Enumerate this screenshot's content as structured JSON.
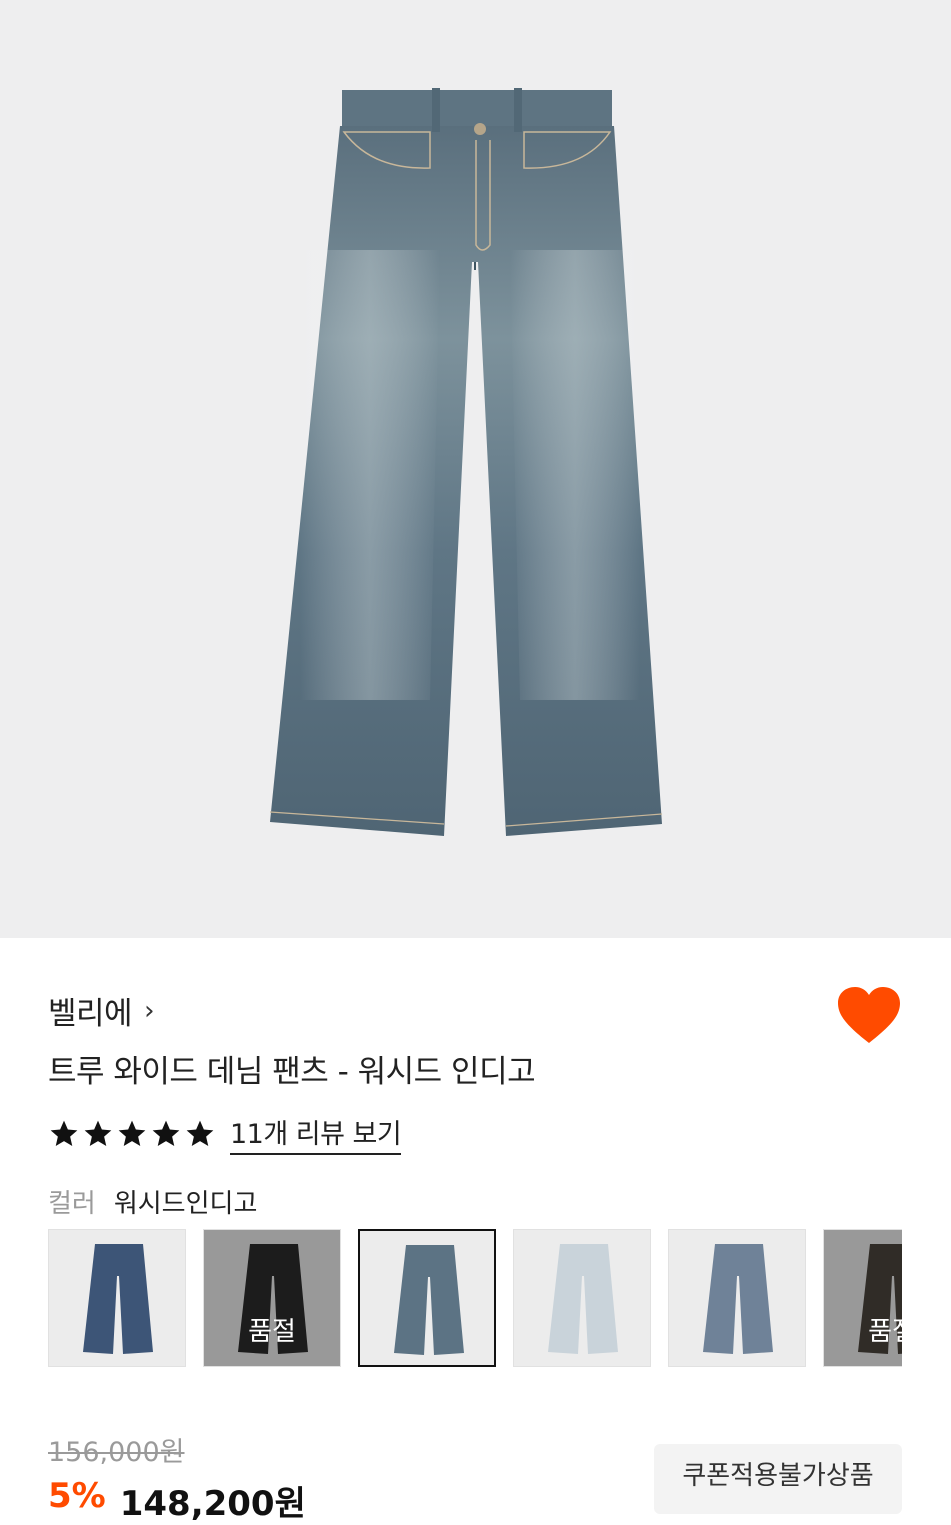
{
  "product": {
    "brand": "벨리에",
    "brand_chevron": "›",
    "title": "트루 와이드 데님 팬츠 - 워시드 인디고",
    "rating_stars": 5,
    "review_link": "11개 리뷰 보기",
    "wishlisted": true
  },
  "color": {
    "label": "컬러",
    "selected": "워시드인디고"
  },
  "swatches": [
    {
      "tone": "#3d5577",
      "soldout": false,
      "selected": false
    },
    {
      "tone": "#2b2b2b",
      "soldout": true,
      "selected": false,
      "soldout_label": "품절"
    },
    {
      "tone": "#5c7384",
      "soldout": false,
      "selected": true
    },
    {
      "tone": "#c9d3da",
      "soldout": false,
      "selected": false
    },
    {
      "tone": "#6f8298",
      "soldout": false,
      "selected": false
    },
    {
      "tone": "#4a443c",
      "soldout": true,
      "selected": false,
      "soldout_label": "품절"
    }
  ],
  "price": {
    "original": "156,000원",
    "discount": "5%",
    "final": "148,200원",
    "coupon_badge": "쿠폰적용불가상품"
  },
  "colors": {
    "accent": "#ff4b00",
    "hero_bg": "#eeeeef",
    "denim": "#5d7482"
  },
  "icons": {
    "heart": "heart-icon",
    "star": "star-icon",
    "chevron": "chevron-right-icon"
  }
}
